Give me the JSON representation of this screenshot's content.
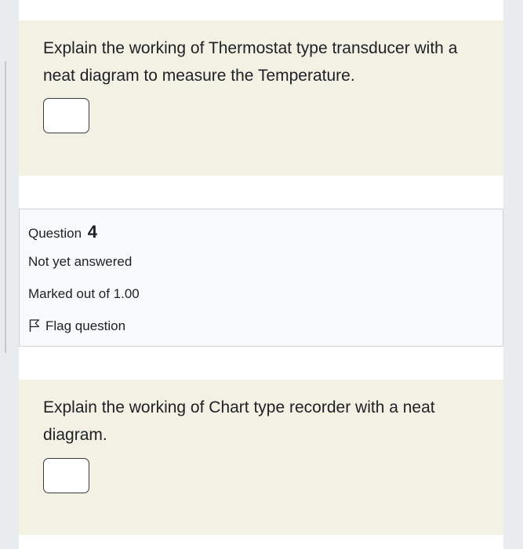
{
  "question3": {
    "text": "Explain the working of Thermostat type transducer with a neat diagram to measure the Temperature."
  },
  "info": {
    "question_label": "Question",
    "question_number": "4",
    "state": "Not yet answered",
    "marked": "Marked out of 1.00",
    "flag_label": "Flag question",
    "flag_icon": "flag-outline-icon"
  },
  "question4": {
    "text": "Explain the working of Chart type recorder with a neat diagram."
  }
}
